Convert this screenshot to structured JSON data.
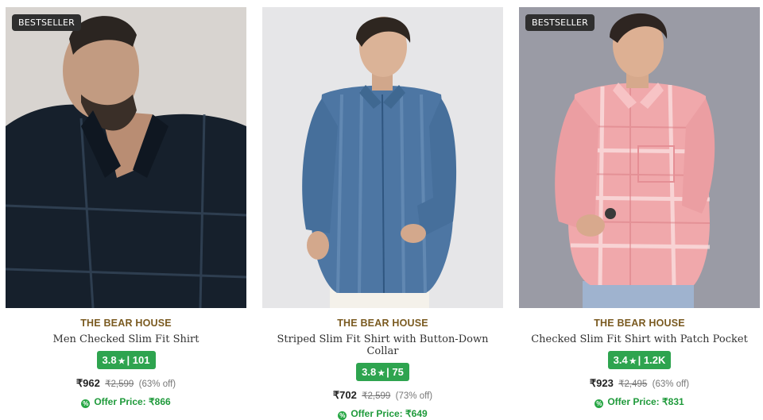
{
  "products": [
    {
      "badge": "BESTSELLER",
      "image": "navy-checked-shirt-model",
      "brand": "THE BEAR HOUSE",
      "title": "Men Checked Slim Fit Shirt",
      "rating": "3.8",
      "rating_count": "101",
      "price": "₹962",
      "mrp": "₹2,599",
      "discount": "(63% off)",
      "offer_label": "Offer Price:",
      "offer_price": "₹866"
    },
    {
      "badge": "",
      "image": "blue-striped-shirt-model",
      "brand": "THE BEAR HOUSE",
      "title": "Striped Slim Fit Shirt with Button-Down Collar",
      "rating": "3.8",
      "rating_count": "75",
      "price": "₹702",
      "mrp": "₹2,599",
      "discount": "(73% off)",
      "offer_label": "Offer Price:",
      "offer_price": "₹649"
    },
    {
      "badge": "BESTSELLER",
      "image": "pink-checked-shirt-model",
      "brand": "THE BEAR HOUSE",
      "title": "Checked Slim Fit Shirt with Patch Pocket",
      "rating": "3.4",
      "rating_count": "1.2K",
      "price": "₹923",
      "mrp": "₹2,495",
      "discount": "(63% off)",
      "offer_label": "Offer Price:",
      "offer_price": "₹831"
    }
  ],
  "colors": {
    "brand_text": "#7a5a20",
    "rating_bg": "#2ea44f",
    "offer_text": "#1f9a3b",
    "badge_bg": "#2f2f2f"
  },
  "icons": {
    "rating_star": "★",
    "offer": "offer-percent-icon"
  }
}
